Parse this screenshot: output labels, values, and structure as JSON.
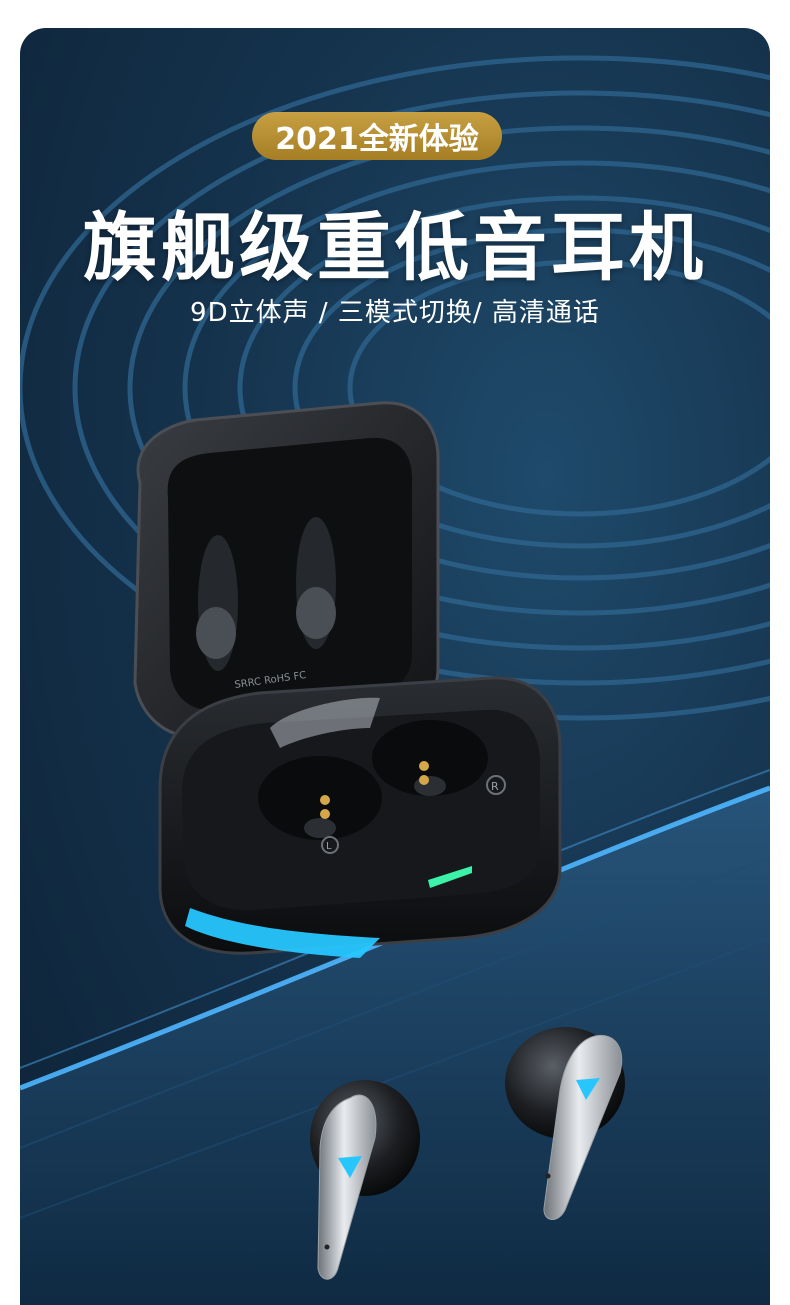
{
  "badge": {
    "text": "2021全新体验"
  },
  "headline": {
    "text": "旗舰级重低音耳机"
  },
  "subline": {
    "text": "9D立体声 / 三模式切换/ 高清通话"
  },
  "case": {
    "compliance_marks": "SRRC RoHS FC",
    "left_marker": "L",
    "right_marker": "R"
  },
  "colors": {
    "background_dark": "#0d2236",
    "background_mid": "#1f4a6b",
    "badge_gold": "#b88f33",
    "led_cyan": "#27c6ff",
    "led_green": "#3cf2a8"
  }
}
